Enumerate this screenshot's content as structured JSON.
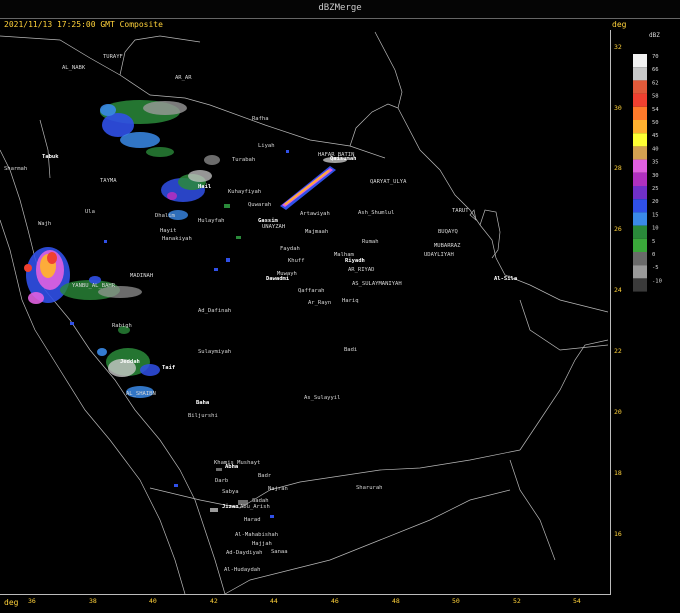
{
  "window": {
    "title": "dBZMerge"
  },
  "header": {
    "timestamp": "2021/11/13 17:25:00 GMT Composite"
  },
  "axis": {
    "unit_left": "deg",
    "unit_right": "deg",
    "x_ticks": [
      "36",
      "38",
      "40",
      "42",
      "44",
      "46",
      "48",
      "50",
      "52",
      "54"
    ],
    "y_ticks": [
      "32",
      "30",
      "28",
      "26",
      "24",
      "22",
      "20",
      "18",
      "16"
    ]
  },
  "legend": {
    "unit": "dBZ",
    "levels": [
      {
        "label": "70",
        "color": "#f2f2f2"
      },
      {
        "label": "66",
        "color": "#c8c8c8"
      },
      {
        "label": "62",
        "color": "#e05a3a"
      },
      {
        "label": "58",
        "color": "#f04030"
      },
      {
        "label": "54",
        "color": "#ff7a2a"
      },
      {
        "label": "50",
        "color": "#ffb030"
      },
      {
        "label": "45",
        "color": "#ffff33"
      },
      {
        "label": "40",
        "color": "#d2a050"
      },
      {
        "label": "35",
        "color": "#e060e0"
      },
      {
        "label": "30",
        "color": "#b030c0"
      },
      {
        "label": "25",
        "color": "#7030c8"
      },
      {
        "label": "20",
        "color": "#3050e8"
      },
      {
        "label": "15",
        "color": "#3a8ae8"
      },
      {
        "label": "10",
        "color": "#2a8a3a"
      },
      {
        "label": "5",
        "color": "#3aa83a"
      },
      {
        "label": "0",
        "color": "#6a6a6a"
      },
      {
        "label": "-5",
        "color": "#9a9a9a"
      },
      {
        "label": "-10",
        "color": "#3a3a3a"
      }
    ]
  },
  "cities": [
    {
      "name": "TURAYF",
      "bold": false
    },
    {
      "name": "AL_NABK",
      "bold": false
    },
    {
      "name": "AR_AR",
      "bold": false
    },
    {
      "name": "Rafha",
      "bold": false
    },
    {
      "name": "Tabuk",
      "bold": true
    },
    {
      "name": "Sharmah",
      "bold": false
    },
    {
      "name": "TAYMA",
      "bold": false
    },
    {
      "name": "Liyah",
      "bold": false
    },
    {
      "name": "HAFAR_BATIN",
      "bold": false
    },
    {
      "name": "Qaisumah",
      "bold": true
    },
    {
      "name": "Turabah",
      "bold": false
    },
    {
      "name": "Hail",
      "bold": true
    },
    {
      "name": "Kuhayfiyah",
      "bold": false
    },
    {
      "name": "QARYAT_ULYA",
      "bold": false
    },
    {
      "name": "Ula",
      "bold": false
    },
    {
      "name": "Quwarah",
      "bold": false
    },
    {
      "name": "Artawiyah",
      "bold": false
    },
    {
      "name": "Ash_Shumlul",
      "bold": false
    },
    {
      "name": "TARUT",
      "bold": false
    },
    {
      "name": "Wajh",
      "bold": false
    },
    {
      "name": "Dhalim",
      "bold": false
    },
    {
      "name": "Hayit",
      "bold": false
    },
    {
      "name": "Hulayfah",
      "bold": false
    },
    {
      "name": "Gassim",
      "bold": true
    },
    {
      "name": "UNAYZAH",
      "bold": false
    },
    {
      "name": "Majmaah",
      "bold": false
    },
    {
      "name": "BUQAYQ",
      "bold": false
    },
    {
      "name": "Hanakiyah",
      "bold": false
    },
    {
      "name": "Faydah",
      "bold": false
    },
    {
      "name": "Rumah",
      "bold": false
    },
    {
      "name": "MUBARRAZ",
      "bold": false
    },
    {
      "name": "UDAYLIYAH",
      "bold": false
    },
    {
      "name": "Khuff",
      "bold": false
    },
    {
      "name": "Malham",
      "bold": false
    },
    {
      "name": "Riyadh",
      "bold": true
    },
    {
      "name": "AR_RIYAD",
      "bold": false
    },
    {
      "name": "MADINAH",
      "bold": false
    },
    {
      "name": "Muwayh",
      "bold": false
    },
    {
      "name": "Dawadmi",
      "bold": true
    },
    {
      "name": "AS_SULAYMANIYAH",
      "bold": false
    },
    {
      "name": "Al-Sila",
      "bold": true
    },
    {
      "name": "YANBU_AL_BAHR",
      "bold": false
    },
    {
      "name": "Qaffarah",
      "bold": false
    },
    {
      "name": "Ar_Rayn",
      "bold": false
    },
    {
      "name": "Hariq",
      "bold": false
    },
    {
      "name": "Ad_Dafinah",
      "bold": false
    },
    {
      "name": "Rabigh",
      "bold": false
    },
    {
      "name": "Badi",
      "bold": false
    },
    {
      "name": "Sulaymiyah",
      "bold": false
    },
    {
      "name": "Jeddah",
      "bold": true
    },
    {
      "name": "Taif",
      "bold": true
    },
    {
      "name": "AL_SHAIBN",
      "bold": false
    },
    {
      "name": "Baha",
      "bold": true
    },
    {
      "name": "As_Sulayyil",
      "bold": false
    },
    {
      "name": "Biljurshi",
      "bold": false
    },
    {
      "name": "Khamis_Mushayt",
      "bold": false
    },
    {
      "name": "Abha",
      "bold": true
    },
    {
      "name": "Badr",
      "bold": false
    },
    {
      "name": "Darb",
      "bold": false
    },
    {
      "name": "Najran",
      "bold": false
    },
    {
      "name": "Sharurah",
      "bold": false
    },
    {
      "name": "Sabya",
      "bold": false
    },
    {
      "name": "Jizan",
      "bold": true
    },
    {
      "name": "Abu_Arish",
      "bold": false
    },
    {
      "name": "Sadah",
      "bold": false
    },
    {
      "name": "Harad",
      "bold": false
    },
    {
      "name": "Al-Mahabishah",
      "bold": false
    },
    {
      "name": "Hajjah",
      "bold": false
    },
    {
      "name": "Ad-Daydiyah",
      "bold": false
    },
    {
      "name": "Sanaa",
      "bold": false
    },
    {
      "name": "Al-Hudaydah",
      "bold": false
    }
  ]
}
